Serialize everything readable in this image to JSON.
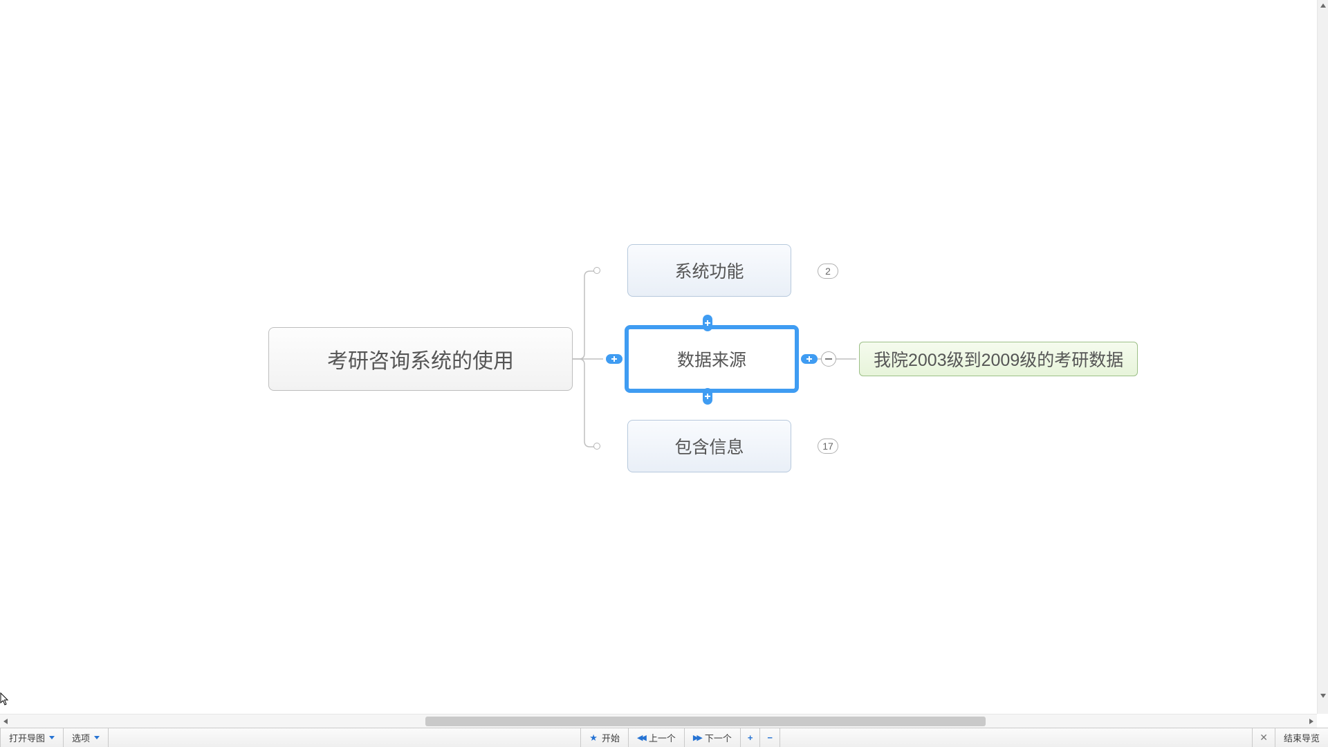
{
  "mindmap": {
    "root": {
      "label": "考研咨询系统的使用"
    },
    "children": [
      {
        "id": "sysfunc",
        "label": "系统功能",
        "collapsed_count": "2"
      },
      {
        "id": "datasrc",
        "label": "数据来源",
        "selected": true,
        "leaf": {
          "label": "我院2003级到2009级的考研数据"
        }
      },
      {
        "id": "contains",
        "label": "包含信息",
        "collapsed_count": "17"
      }
    ]
  },
  "toolbar": {
    "open_map": "打开导图",
    "options": "选项",
    "start": "开始",
    "prev": "上一个",
    "next": "下一个",
    "end_nav": "结束导览"
  }
}
